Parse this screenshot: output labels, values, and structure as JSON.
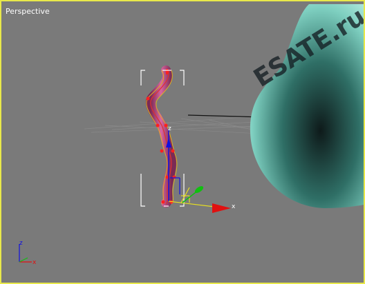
{
  "viewport": {
    "label": "Perspective",
    "border_color": "#e8e84a",
    "background": "#7a7a7a"
  },
  "watermark": {
    "text": "ESATE.ru"
  },
  "gizmo": {
    "z_label": "z",
    "x_label": "x",
    "colors": {
      "x": "#e01010",
      "y": "#10c010",
      "z": "#1010e0"
    }
  },
  "corner_axes": {
    "z_label": "z",
    "x_label": "x"
  },
  "objects": {
    "bent_tube": {
      "color": "#c8508a",
      "selection": "white-brackets"
    },
    "teal_shape": {
      "color": "#7ecfc0"
    }
  }
}
